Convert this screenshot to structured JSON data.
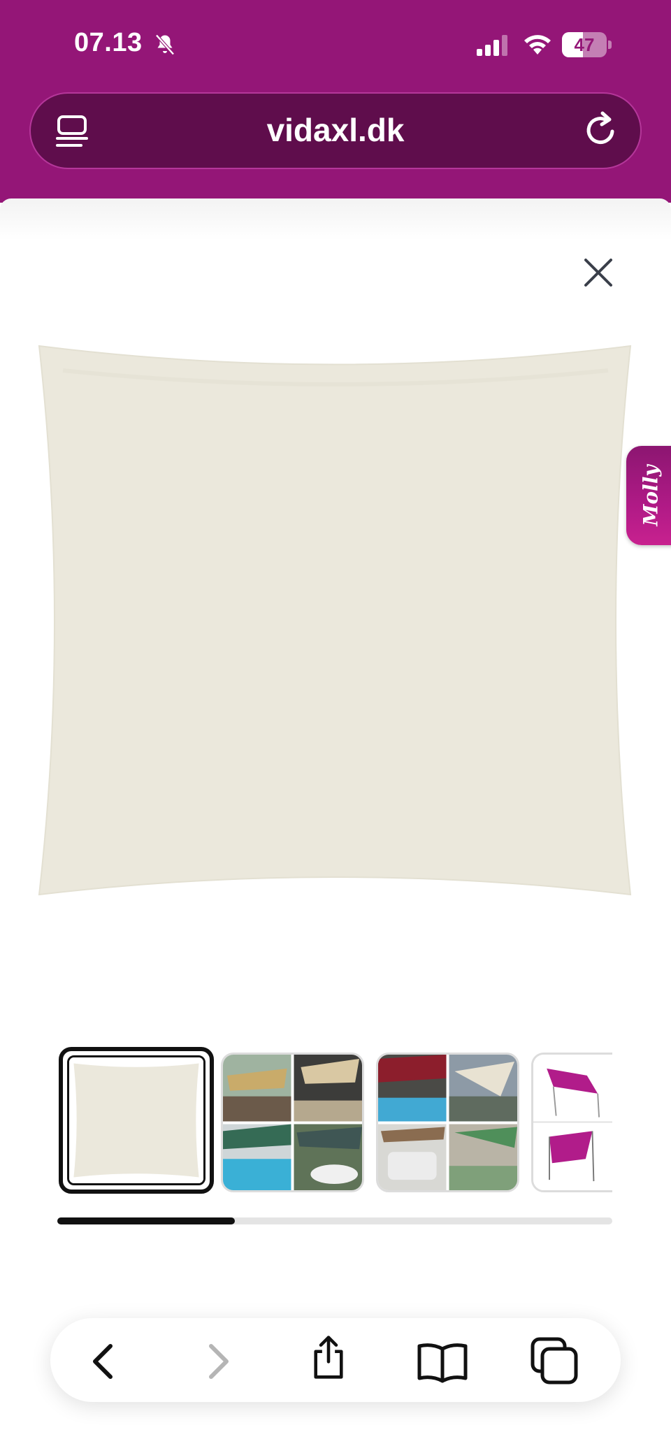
{
  "status_bar": {
    "time": "07.13",
    "battery": "47",
    "battery_level": 0.47,
    "icons": [
      "bell-slash-icon",
      "cellular-signal-icon",
      "wifi-icon",
      "battery-icon"
    ]
  },
  "browser": {
    "url": "vidaxl.dk",
    "left_icon": "reader-mode-icon",
    "right_icon": "reload-icon"
  },
  "gallery": {
    "close_icon": "close-icon",
    "selected_index": 0,
    "scroll_progress": 0.32,
    "thumbnails": [
      {
        "name": "thumbnail-plain-sail",
        "selected": true
      },
      {
        "name": "thumbnail-lifestyle-collage-1",
        "selected": false
      },
      {
        "name": "thumbnail-lifestyle-collage-2",
        "selected": false
      },
      {
        "name": "thumbnail-installation-diagram",
        "selected": false
      }
    ]
  },
  "side_tab": {
    "label": "Molly"
  },
  "toolbar": {
    "buttons": [
      "back-icon",
      "forward-icon",
      "share-icon",
      "bookmarks-icon",
      "tabs-icon"
    ]
  },
  "colors": {
    "brand": "#941677",
    "url_bar": "#5f0d4c",
    "sail": "#ebe8dc",
    "accent_thumb": "#b11c8a"
  }
}
